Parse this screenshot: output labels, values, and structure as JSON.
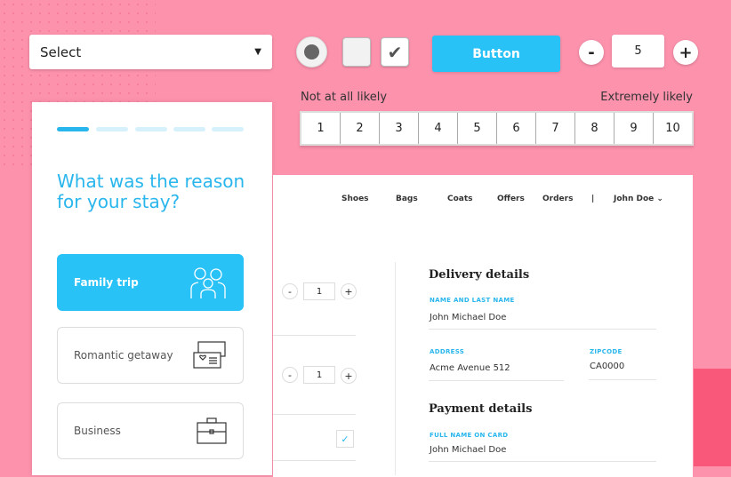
{
  "select": {
    "value": "Select"
  },
  "button": {
    "label": "Button"
  },
  "stepper": {
    "minus": "-",
    "value": "5",
    "plus": "+"
  },
  "checkbox": {
    "check": "✔"
  },
  "scale": {
    "low_label": "Not at all likely",
    "high_label": "Extremely likely",
    "options": [
      "1",
      "2",
      "3",
      "4",
      "5",
      "6",
      "7",
      "8",
      "9",
      "10"
    ]
  },
  "survey": {
    "question": "What was the reason for your stay?",
    "progress_step": 1,
    "progress_total": 5,
    "options": [
      {
        "label": "Family trip",
        "icon": "family-icon",
        "selected": true
      },
      {
        "label": "Romantic getaway",
        "icon": "tickets-icon"
      },
      {
        "label": "Business",
        "icon": "briefcase-icon"
      }
    ]
  },
  "shop": {
    "nav": [
      "Shoes",
      "Bags",
      "Coats",
      "Offers",
      "Orders"
    ],
    "separator": "|",
    "user": "John Doe",
    "items": [
      {
        "minus": "-",
        "qty": "1",
        "plus": "+"
      },
      {
        "minus": "-",
        "qty": "1",
        "plus": "+"
      }
    ],
    "check": "✓",
    "delivery": {
      "title": "Delivery details",
      "name_label": "NAME AND LAST NAME",
      "name": "John Michael Doe",
      "address_label": "ADDRESS",
      "address": "Acme Avenue 512",
      "zip_label": "ZIPCODE",
      "zip": "CA0000"
    },
    "payment": {
      "title": "Payment details",
      "card_name_label": "FULL NAME ON CARD",
      "card_name": "John Michael Doe"
    }
  },
  "colors": {
    "background": "#fd92ad",
    "accent": "#29c2f7",
    "corner": "#f9587a"
  }
}
